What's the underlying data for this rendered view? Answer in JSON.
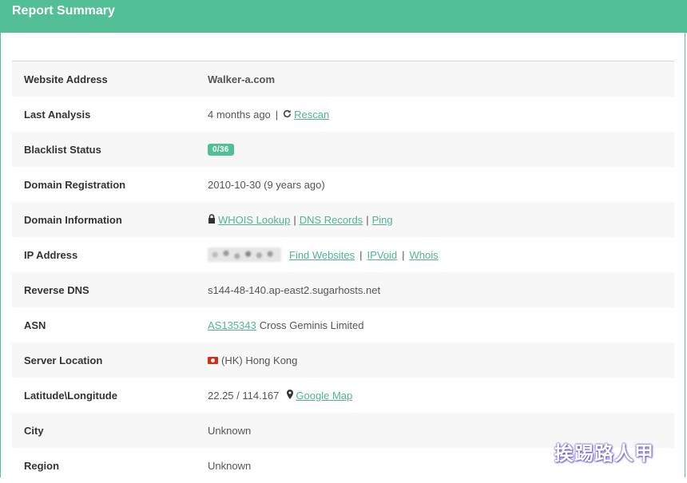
{
  "header": {
    "title": "Report Summary"
  },
  "rows": {
    "website": {
      "label": "Website Address",
      "value": "Walker-a.com"
    },
    "last_analysis": {
      "label": "Last Analysis",
      "value": "4 months ago",
      "sep": "|",
      "rescan": "Rescan"
    },
    "blacklist": {
      "label": "Blacklist Status",
      "badge": "0/36"
    },
    "domain_registration": {
      "label": "Domain Registration",
      "value": "2010-10-30 (9 years ago)"
    },
    "domain_information": {
      "label": "Domain Information",
      "whois": "WHOIS Lookup",
      "dns": "DNS Records",
      "ping": "Ping",
      "sep": "|"
    },
    "ip_address": {
      "label": "IP Address",
      "find": "Find Websites",
      "ipvoid": "IPVoid",
      "whois": "Whois",
      "sep": "|"
    },
    "reverse_dns": {
      "label": "Reverse DNS",
      "value": "s144-48-140.ap-east2.sugarhosts.net"
    },
    "asn": {
      "label": "ASN",
      "link": "AS135343",
      "value": "Cross Geminis Limited"
    },
    "server_location": {
      "label": "Server Location",
      "value": "(HK) Hong Kong"
    },
    "latlong": {
      "label": "Latitude\\Longitude",
      "value": "22.25 / 114.167",
      "map": "Google Map"
    },
    "city": {
      "label": "City",
      "value": "Unknown"
    },
    "region": {
      "label": "Region",
      "value": "Unknown"
    }
  },
  "icons": {
    "rescan": "refresh-icon",
    "whois": "lock-icon",
    "map": "map-marker-icon",
    "flag": "hk-flag-icon"
  },
  "colors": {
    "accent": "#52bf96",
    "link": "#52b38f"
  },
  "watermark": "挨踢路人甲"
}
